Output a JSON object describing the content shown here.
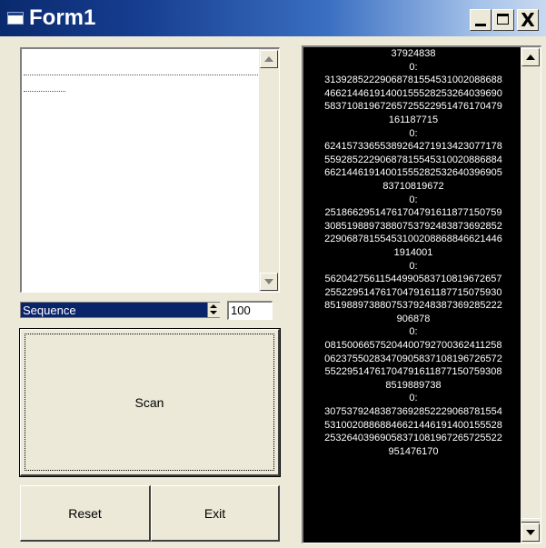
{
  "window": {
    "title": "Form1",
    "minimize_icon": "minimize-icon",
    "maximize_icon": "maximize-icon",
    "close_glyph": "X"
  },
  "sequence": {
    "label": "Sequence",
    "count_value": "100"
  },
  "buttons": {
    "scan": "Scan",
    "reset": "Reset",
    "exit": "Exit"
  },
  "output": {
    "text": "37924838\n0:\n31392852229068781554531002088688\n46621446191400155528253264039690\n58371081967265725522951476170479\n161187715\n0:\n62415733655389264271913423077178\n55928522290687815545310020886884\n66214461914001555282532640396905\n83710819672\n0:\n25186629514761704791611877150759\n30851988973880753792483873692852\n22906878155453100208868846621446\n1914001\n0:\n56204275611544990583710819672657\n25522951476170479161187715075930\n85198897388075379248387369285222\n906878\n0:\n08150066575204400792700362411258\n06237550283470905837108196726572\n55229514761704791611877150759308\n8519889738\n0:\n30753792483873692852229068781554\n53100208868846621446191400155528\n25326403969058371081967265725522\n951476170"
  },
  "colors": {
    "title_bar": "#0a2a6e",
    "face": "#ece9d8",
    "selection": "#0a246a",
    "output_bg": "#000000",
    "output_text": "#ffffff"
  }
}
